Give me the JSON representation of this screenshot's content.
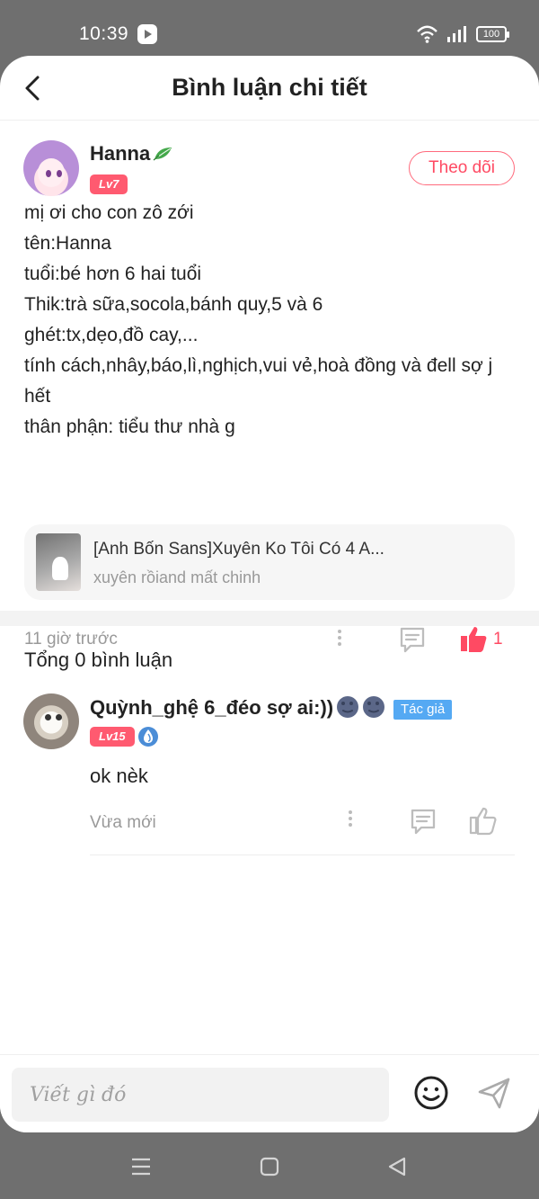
{
  "status": {
    "time": "10:39",
    "battery": "100"
  },
  "header": {
    "title": "Bình luận chi tiết",
    "back_icon": "back-arrow-icon"
  },
  "post": {
    "username": "Hanna",
    "level": "Lv7",
    "follow_label": "Theo dõi",
    "body_lines": [
      "mị ơi cho con zô zới",
      "tên:Hanna",
      "tuổi:bé hơn 6 hai tuổi",
      "Thik:trà sữa,socola,bánh quy,5 và 6",
      "ghét:tx,dẹo,đồ cay,...",
      "tính cách,nhây,báo,lì,nghịch,vui vẻ,hoà đồng và đell sợ j hết",
      "thân phận: tiểu thư nhà g"
    ],
    "story": {
      "title": "[Anh Bốn Sans]Xuyên Ko Tôi Có 4 A...",
      "subtitle": "xuyên rồiand mất chinh"
    },
    "time": "11 giờ trước",
    "like_count": "1"
  },
  "comments": {
    "total_label": "Tổng 0 bình luận",
    "items": [
      {
        "username": "Quỳnh_ghệ 6_đéo sợ ai:))",
        "author_badge": "Tác giả",
        "level": "Lv15",
        "text": "ok nèk",
        "time": "Vừa mới"
      }
    ]
  },
  "composer": {
    "placeholder": "Viết gì đó"
  },
  "colors": {
    "accent": "#ff4a63",
    "level_badge": "#ff5a70",
    "author_badge": "#55a9f3",
    "muted_text": "#999999"
  },
  "icons": [
    "back-arrow-icon",
    "leaf-icon",
    "more-icon",
    "comment-icon",
    "like-icon",
    "moon-icon",
    "water-drop-icon",
    "emoji-icon",
    "send-icon",
    "menu-icon",
    "home-icon",
    "back-nav-icon"
  ]
}
